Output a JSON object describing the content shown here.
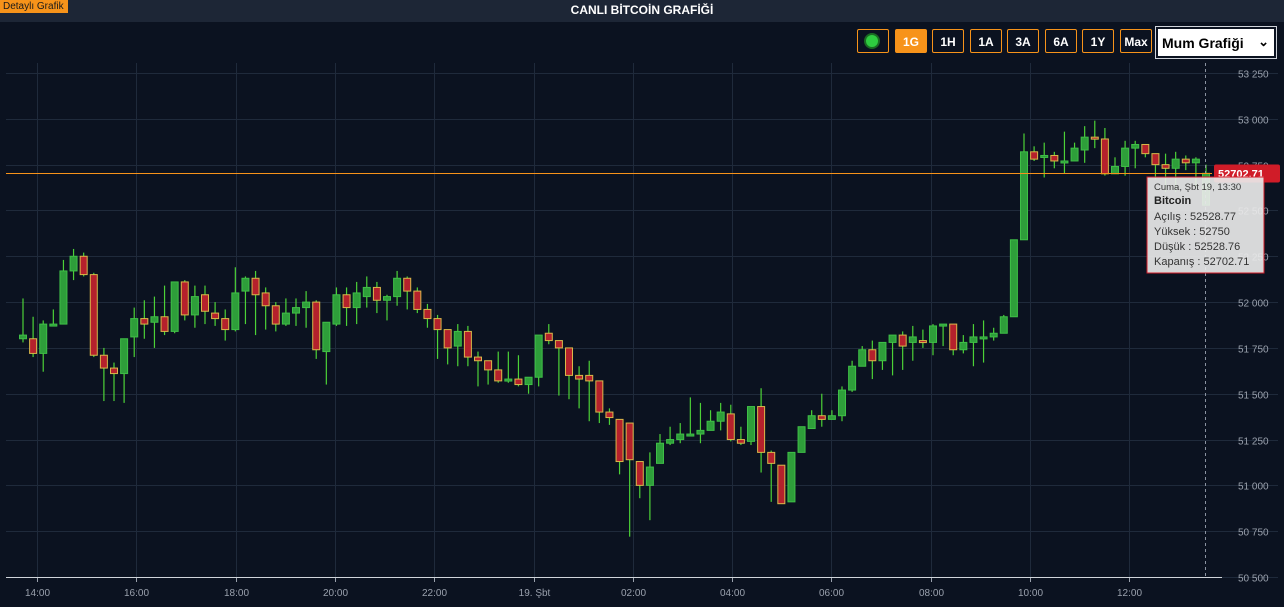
{
  "header": {
    "detail_link": "Detaylı Grafik",
    "title": "CANLI BİTCOİN GRAFİĞİ"
  },
  "controls": {
    "ranges": [
      "1G",
      "1H",
      "1A",
      "3A",
      "6A",
      "1Y",
      "Max"
    ],
    "active_range": "1G",
    "chart_type_select": "Mum Grafiği"
  },
  "colors": {
    "up": "#2e9e3a",
    "down": "#b5212c",
    "wick": "#4cd137",
    "price_line": "#f7931a",
    "price_label": "#d01c28"
  },
  "price_label": "52702.71",
  "tooltip": {
    "date": "Cuma, Şbt 19, 13:30",
    "series": "Bitcoin",
    "rows": [
      {
        "label": "Açılış",
        "value": "52528.77"
      },
      {
        "label": "Yüksek",
        "value": "52750"
      },
      {
        "label": "Düşük",
        "value": "52528.76"
      },
      {
        "label": "Kapanış",
        "value": "52702.71"
      }
    ]
  },
  "chart_data": {
    "type": "candlestick",
    "title": "",
    "xlabel": "",
    "ylabel": "",
    "series_name": "Bitcoin",
    "ylim": [
      50500,
      53250
    ],
    "y_ticks": [
      "53 250",
      "53 000",
      "52 750",
      "52 500",
      "52 250",
      "52 000",
      "51 750",
      "51 500",
      "51 250",
      "51 000",
      "50 750",
      "50 500"
    ],
    "x_ticks": [
      "14:00",
      "16:00",
      "18:00",
      "20:00",
      "22:00",
      "19. Şbt",
      "02:00",
      "04:00",
      "06:00",
      "08:00",
      "10:00",
      "12:00"
    ],
    "grid": true,
    "candles": [
      [
        51800,
        51820,
        52020,
        51780
      ],
      [
        51800,
        51720,
        51920,
        51700
      ],
      [
        51720,
        51880,
        51900,
        51620
      ],
      [
        51880,
        51880,
        51960,
        51870
      ],
      [
        51880,
        52170,
        52230,
        51880
      ],
      [
        52170,
        52250,
        52290,
        52120
      ],
      [
        52250,
        52150,
        52270,
        52140
      ],
      [
        52150,
        51710,
        52160,
        51700
      ],
      [
        51710,
        51640,
        51750,
        51460
      ],
      [
        51640,
        51610,
        51670,
        51460
      ],
      [
        51610,
        51800,
        51800,
        51450
      ],
      [
        51810,
        51910,
        51970,
        51700
      ],
      [
        51910,
        51880,
        52010,
        51800
      ],
      [
        51890,
        51920,
        52030,
        51750
      ],
      [
        51920,
        51840,
        52090,
        51820
      ],
      [
        51840,
        52110,
        52110,
        51830
      ],
      [
        52110,
        51930,
        52120,
        51900
      ],
      [
        51930,
        52030,
        52090,
        51860
      ],
      [
        52040,
        51950,
        52090,
        51880
      ],
      [
        51940,
        51910,
        52000,
        51870
      ],
      [
        51910,
        51850,
        51960,
        51790
      ],
      [
        51850,
        52050,
        52190,
        51840
      ],
      [
        52060,
        52130,
        52140,
        51880
      ],
      [
        52130,
        52040,
        52170,
        51820
      ],
      [
        52050,
        51980,
        52080,
        51850
      ],
      [
        51980,
        51880,
        52000,
        51840
      ],
      [
        51880,
        51940,
        52020,
        51870
      ],
      [
        51940,
        51970,
        52020,
        51870
      ],
      [
        51970,
        52000,
        52060,
        51860
      ],
      [
        52000,
        51740,
        52010,
        51690
      ],
      [
        51730,
        51890,
        51890,
        51550
      ],
      [
        51880,
        52040,
        52080,
        51870
      ],
      [
        52040,
        51970,
        52080,
        51870
      ],
      [
        51970,
        52050,
        52110,
        51880
      ],
      [
        52030,
        52080,
        52140,
        51970
      ],
      [
        52080,
        52010,
        52110,
        51940
      ],
      [
        52010,
        52030,
        52040,
        51900
      ],
      [
        52030,
        52130,
        52170,
        51980
      ],
      [
        52130,
        52060,
        52140,
        51960
      ],
      [
        52060,
        51960,
        52080,
        51940
      ],
      [
        51960,
        51910,
        51990,
        51860
      ],
      [
        51910,
        51850,
        51930,
        51690
      ],
      [
        51850,
        51750,
        51850,
        51660
      ],
      [
        51760,
        51840,
        51880,
        51650
      ],
      [
        51840,
        51700,
        51870,
        51650
      ],
      [
        51700,
        51680,
        51730,
        51540
      ],
      [
        51680,
        51630,
        51670,
        51550
      ],
      [
        51630,
        51570,
        51730,
        51560
      ],
      [
        51570,
        51580,
        51730,
        51560
      ],
      [
        51580,
        51550,
        51710,
        51540
      ],
      [
        51550,
        51590,
        51590,
        51500
      ],
      [
        51590,
        51820,
        51820,
        51540
      ],
      [
        51830,
        51790,
        51880,
        51770
      ],
      [
        51790,
        51750,
        51760,
        51490
      ],
      [
        51750,
        51600,
        51730,
        51470
      ],
      [
        51600,
        51580,
        51650,
        51420
      ],
      [
        51600,
        51570,
        51680,
        51350
      ],
      [
        51570,
        51400,
        51530,
        51340
      ],
      [
        51400,
        51370,
        51420,
        51330
      ],
      [
        51360,
        51130,
        51360,
        51060
      ],
      [
        51340,
        51140,
        51340,
        50720
      ],
      [
        51130,
        51000,
        51040,
        50930
      ],
      [
        51000,
        51100,
        51180,
        50810
      ],
      [
        51120,
        51230,
        51280,
        51210
      ],
      [
        51230,
        51250,
        51320,
        51220
      ],
      [
        51250,
        51280,
        51340,
        51230
      ],
      [
        51280,
        51280,
        51480,
        51270
      ],
      [
        51280,
        51300,
        51450,
        51230
      ],
      [
        51300,
        51350,
        51410,
        51320
      ],
      [
        51350,
        51400,
        51450,
        51300
      ],
      [
        51390,
        51250,
        51440,
        51240
      ],
      [
        51250,
        51230,
        51320,
        51220
      ],
      [
        51240,
        51430,
        51430,
        51220
      ],
      [
        51430,
        51180,
        51530,
        51070
      ],
      [
        51180,
        51120,
        51190,
        50910
      ],
      [
        51110,
        50900,
        50920,
        50900
      ],
      [
        50910,
        51180,
        51180,
        50910
      ],
      [
        51180,
        51320,
        51310,
        51190
      ],
      [
        51310,
        51380,
        51410,
        51330
      ],
      [
        51380,
        51360,
        51500,
        51320
      ],
      [
        51360,
        51380,
        51410,
        51360
      ],
      [
        51380,
        51520,
        51540,
        51350
      ],
      [
        51520,
        51650,
        51680,
        51510
      ],
      [
        51650,
        51740,
        51760,
        51650
      ],
      [
        51740,
        51680,
        51790,
        51580
      ],
      [
        51680,
        51780,
        51780,
        51630
      ],
      [
        51780,
        51820,
        51820,
        51600
      ],
      [
        51820,
        51760,
        51840,
        51630
      ],
      [
        51780,
        51810,
        51870,
        51680
      ],
      [
        51790,
        51780,
        51850,
        51750
      ],
      [
        51780,
        51870,
        51880,
        51710
      ],
      [
        51880,
        51880,
        51880,
        51760
      ],
      [
        51880,
        51740,
        51880,
        51710
      ],
      [
        51740,
        51780,
        51820,
        51720
      ],
      [
        51780,
        51810,
        51880,
        51650
      ],
      [
        51810,
        51810,
        51900,
        51670
      ],
      [
        51810,
        51830,
        51860,
        51790
      ],
      [
        51830,
        51920,
        51930,
        51830
      ],
      [
        51920,
        52340,
        52340,
        51930
      ],
      [
        52340,
        52820,
        52920,
        52680
      ],
      [
        52820,
        52780,
        52850,
        52770
      ],
      [
        52800,
        52800,
        52870,
        52680
      ],
      [
        52800,
        52770,
        52820,
        52730
      ],
      [
        52770,
        52770,
        52930,
        52700
      ],
      [
        52770,
        52840,
        52870,
        52780
      ],
      [
        52830,
        52900,
        52960,
        52760
      ],
      [
        52900,
        52890,
        52990,
        52840
      ],
      [
        52890,
        52700,
        52950,
        52690
      ],
      [
        52700,
        52740,
        52790,
        52700
      ],
      [
        52740,
        52840,
        52880,
        52690
      ],
      [
        52840,
        52860,
        52880,
        52730
      ],
      [
        52860,
        52810,
        52820,
        52790
      ],
      [
        52810,
        52750,
        52800,
        52670
      ],
      [
        52750,
        52730,
        52810,
        52600
      ],
      [
        52730,
        52780,
        52820,
        52600
      ],
      [
        52780,
        52760,
        52800,
        52720
      ],
      [
        52760,
        52780,
        52790,
        52620
      ],
      [
        52528.77,
        52702.71,
        52750,
        52528.76
      ]
    ]
  }
}
